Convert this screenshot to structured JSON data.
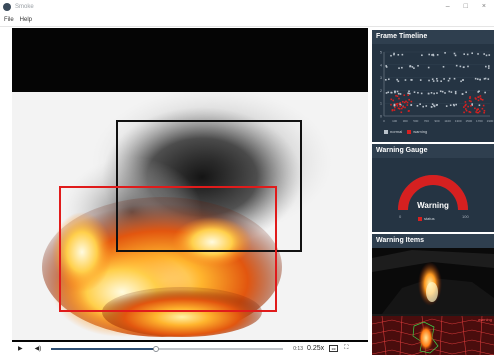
{
  "window": {
    "title": "Smoke",
    "minimize": "–",
    "maximize": "□",
    "close": "×"
  },
  "menu": [
    "File",
    "Help"
  ],
  "video": {
    "boxes": [
      {
        "name": "smoke-detection-box",
        "color": "#111111"
      },
      {
        "name": "fire-detection-box",
        "color": "#e01b1b"
      }
    ]
  },
  "controls": {
    "play_icon": "▶",
    "volume_icon": "◀)",
    "progress": 0.45,
    "time": "0:13",
    "speed": "0.25x",
    "subs_icon": "cc",
    "fullscreen_icon": "⛶"
  },
  "panels": {
    "timeline": {
      "title": "Frame Timeline",
      "y_ticks": [
        "5",
        "4",
        "3",
        "2",
        "1",
        "0"
      ],
      "x_ticks": [
        "0",
        "100",
        "300",
        "500",
        "700",
        "900",
        "1100",
        "1300",
        "1500",
        "1700",
        "1900"
      ],
      "legend": [
        {
          "label": "normal",
          "color": "#b9c2cb"
        },
        {
          "label": "warning",
          "color": "#d62020"
        }
      ]
    },
    "gauge": {
      "title": "Warning Gauge",
      "label": "Warning",
      "status_label": "status",
      "value": 1.0,
      "min": "0",
      "max": "100",
      "color": "#d62020"
    },
    "items": {
      "title": "Warning Items",
      "item2_tag": "warning"
    }
  }
}
